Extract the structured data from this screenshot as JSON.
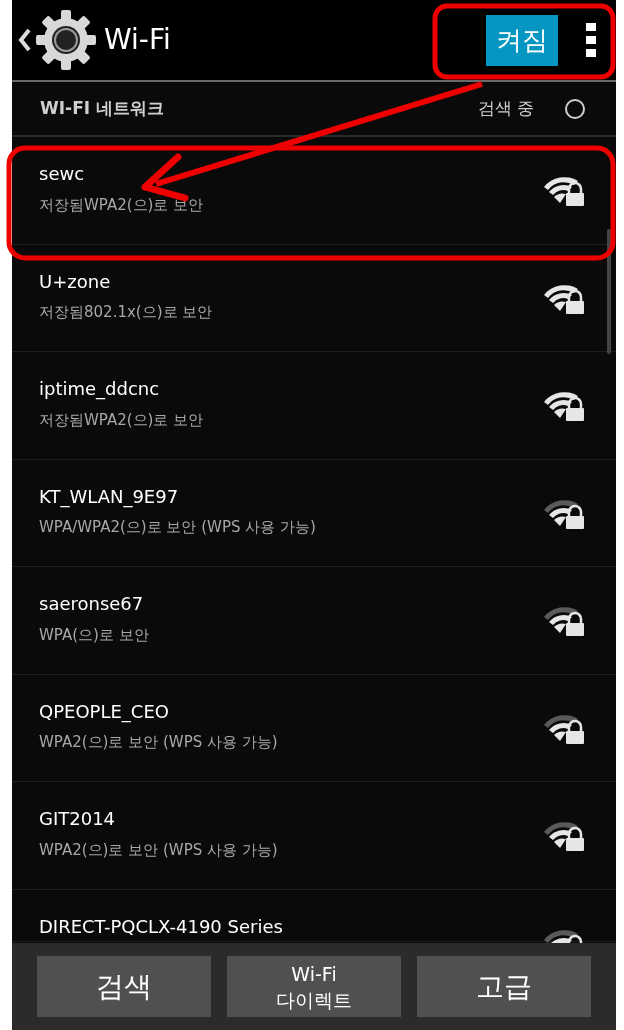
{
  "header": {
    "title": "Wi-Fi",
    "toggle": {
      "label": "켜짐",
      "on": true
    }
  },
  "section": {
    "title": "WI-FI 네트워크",
    "status": "검색 중"
  },
  "networks": [
    {
      "name": "sewc",
      "detail": "저장됨WPA2(으)로 보안",
      "strong": true
    },
    {
      "name": "U+zone",
      "detail": "저장됨802.1x(으)로 보안",
      "strong": true
    },
    {
      "name": "iptime_ddcnc",
      "detail": "저장됨WPA2(으)로 보안",
      "strong": true
    },
    {
      "name": "KT_WLAN_9E97",
      "detail": "WPA/WPA2(으)로 보안 (WPS 사용 가능)",
      "strong": false
    },
    {
      "name": "saeronse67",
      "detail": "WPA(으)로 보안",
      "strong": false
    },
    {
      "name": "QPEOPLE_CEO",
      "detail": "WPA2(으)로 보안 (WPS 사용 가능)",
      "strong": false
    },
    {
      "name": "GIT2014",
      "detail": "WPA2(으)로 보안 (WPS 사용 가능)",
      "strong": false
    },
    {
      "name": "DIRECT-PQCLX-4190 Series",
      "strong": false
    }
  ],
  "buttons": [
    {
      "lines": [
        "검색"
      ]
    },
    {
      "lines": [
        "Wi-Fi",
        "다이렉트"
      ]
    },
    {
      "lines": [
        "고급"
      ]
    }
  ]
}
